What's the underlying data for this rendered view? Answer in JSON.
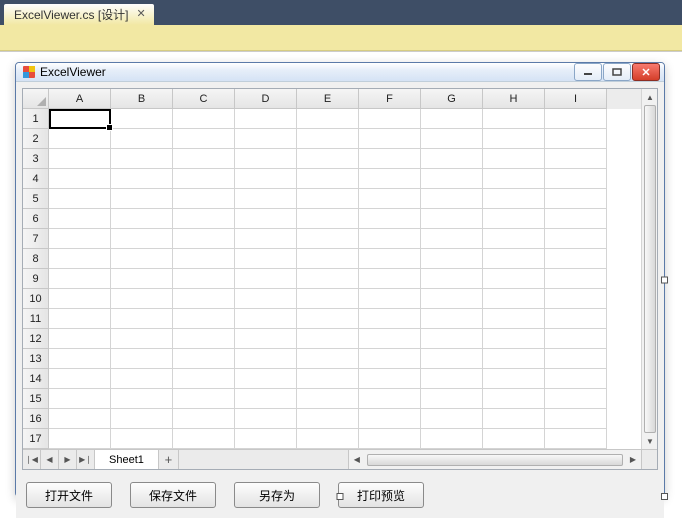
{
  "ide": {
    "tab_label": "ExcelViewer.cs [设计]"
  },
  "window": {
    "title": "ExcelViewer"
  },
  "spreadsheet": {
    "columns": [
      "A",
      "B",
      "C",
      "D",
      "E",
      "F",
      "G",
      "H",
      "I"
    ],
    "rows": [
      "1",
      "2",
      "3",
      "4",
      "5",
      "6",
      "7",
      "8",
      "9",
      "10",
      "11",
      "12",
      "13",
      "14",
      "15",
      "16",
      "17"
    ],
    "selected_cell": "A1",
    "sheet_name": "Sheet1"
  },
  "buttons": {
    "open": "打开文件",
    "save": "保存文件",
    "saveas": "另存为",
    "preview": "打印预览"
  }
}
